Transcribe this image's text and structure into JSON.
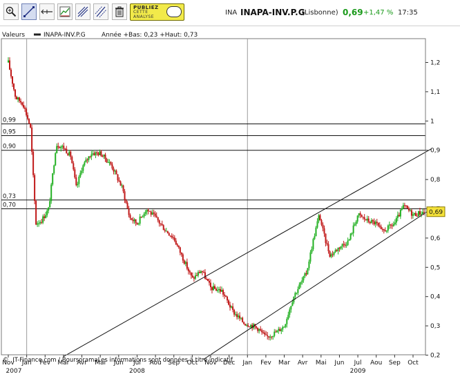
{
  "toolbar": {
    "publiez": {
      "line1": "PUBLIEZ",
      "line2": "CETTE",
      "line3": "ANALYSE"
    }
  },
  "quote": {
    "code": "INA",
    "name": "INAPA-INV.P.G",
    "market": "(Lisbonne)",
    "price": "0,69",
    "change": "+1,47 %",
    "time": "17:35"
  },
  "legend": {
    "label": "Valeurs",
    "series": "INAPA-INV.P.G",
    "stats": "Année +Bas: 0,23 +Haut: 0,73"
  },
  "colors": {
    "up": "#22b022",
    "down": "#c01818",
    "price_badge": "#f5e23a",
    "positive": "#1a9a1a"
  },
  "chart_data": {
    "type": "candlestick",
    "x_ticks": [
      "Nov",
      "Jan",
      "Fev",
      "Mar",
      "Avr",
      "Mai",
      "Jun",
      "Jul",
      "Aou",
      "Sep",
      "Oct",
      "Nov",
      "Dec",
      "Jan",
      "Fev",
      "Mar",
      "Avr",
      "Mai",
      "Jun",
      "Jul",
      "Aou",
      "Sep",
      "Oct"
    ],
    "year_labels": [
      "2007",
      "2008",
      "2009"
    ],
    "y_ticks": [
      "1,2",
      "1,1",
      "1",
      "0,9",
      "0,8",
      "0,7",
      "0,6",
      "0,5",
      "0,4",
      "0,3",
      "0,2"
    ],
    "ylim": [
      0.185,
      1.285
    ],
    "last_price": "0,69",
    "horizontal_lines": [
      {
        "value": 0.99,
        "label": "0,99"
      },
      {
        "value": 0.95,
        "label": "0,95"
      },
      {
        "value": 0.9,
        "label": "0,90"
      },
      {
        "value": 0.73,
        "label": "0,73"
      },
      {
        "value": 0.7,
        "label": "0,70"
      }
    ],
    "trendlines": [
      {
        "from": [
          3.0,
          0.195
        ],
        "to": [
          23.0,
          0.905
        ]
      },
      {
        "from": [
          10.6,
          0.185
        ],
        "to": [
          23.0,
          0.7
        ]
      }
    ],
    "waypoints": [
      [
        0.0,
        1.2
      ],
      [
        0.4,
        1.08
      ],
      [
        0.8,
        1.06
      ],
      [
        1.2,
        0.98
      ],
      [
        1.5,
        0.65
      ],
      [
        1.8,
        0.66
      ],
      [
        2.2,
        0.7
      ],
      [
        2.6,
        0.92
      ],
      [
        3.0,
        0.91
      ],
      [
        3.4,
        0.88
      ],
      [
        3.7,
        0.77
      ],
      [
        4.0,
        0.84
      ],
      [
        4.5,
        0.89
      ],
      [
        5.0,
        0.89
      ],
      [
        5.6,
        0.85
      ],
      [
        6.2,
        0.77
      ],
      [
        6.6,
        0.67
      ],
      [
        7.0,
        0.65
      ],
      [
        7.5,
        0.7
      ],
      [
        8.0,
        0.67
      ],
      [
        8.5,
        0.63
      ],
      [
        9.0,
        0.6
      ],
      [
        9.5,
        0.53
      ],
      [
        10.0,
        0.46
      ],
      [
        10.5,
        0.49
      ],
      [
        11.0,
        0.43
      ],
      [
        11.6,
        0.42
      ],
      [
        12.2,
        0.35
      ],
      [
        12.8,
        0.31
      ],
      [
        13.3,
        0.3
      ],
      [
        13.6,
        0.29
      ],
      [
        14.0,
        0.26
      ],
      [
        14.6,
        0.28
      ],
      [
        15.0,
        0.3
      ],
      [
        15.5,
        0.4
      ],
      [
        16.2,
        0.48
      ],
      [
        16.6,
        0.6
      ],
      [
        16.9,
        0.68
      ],
      [
        17.2,
        0.6
      ],
      [
        17.5,
        0.54
      ],
      [
        18.0,
        0.57
      ],
      [
        18.5,
        0.59
      ],
      [
        19.0,
        0.68
      ],
      [
        19.5,
        0.66
      ],
      [
        20.0,
        0.65
      ],
      [
        20.3,
        0.62
      ],
      [
        21.0,
        0.65
      ],
      [
        21.5,
        0.71
      ],
      [
        22.0,
        0.68
      ],
      [
        22.6,
        0.69
      ]
    ]
  }
}
